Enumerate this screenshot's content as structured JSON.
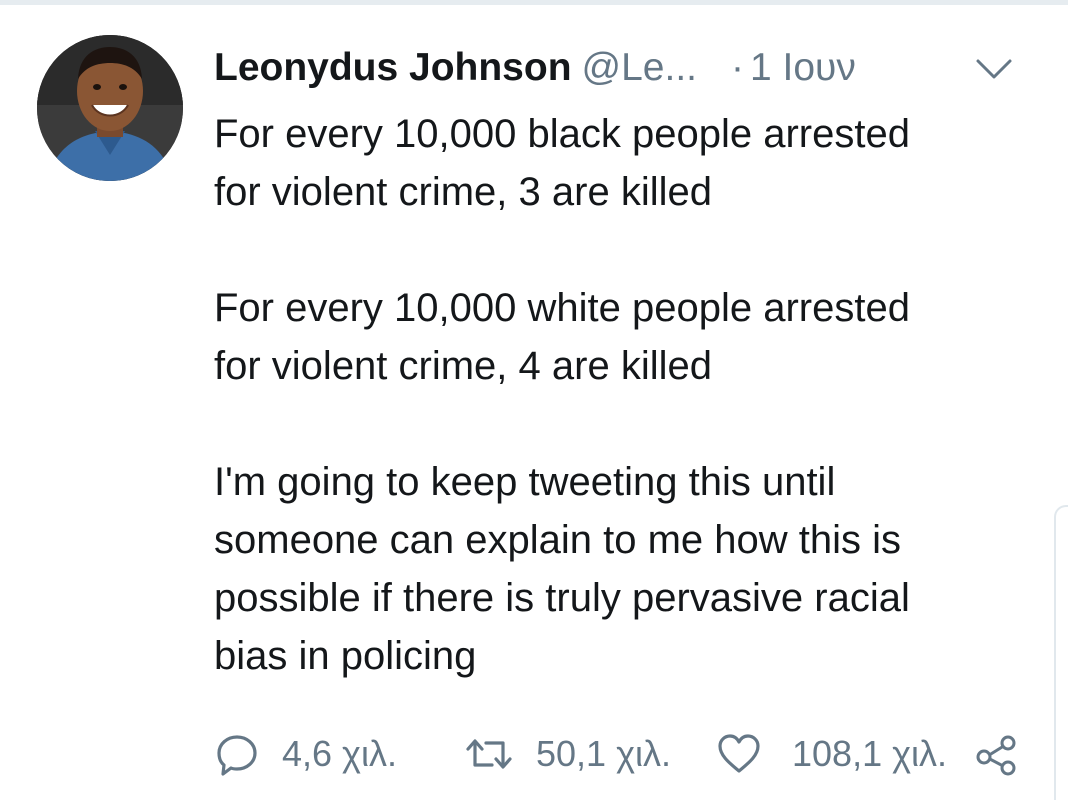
{
  "tweet": {
    "author": {
      "display_name": "Leonydus Johnson",
      "handle": "@Le...",
      "avatar": "profile-photo"
    },
    "separator": "·",
    "timestamp": "1 Ιουν",
    "menu_icon": "chevron-down-icon",
    "text_lines": [
      "For every 10,000 black people arrested",
      "for violent crime, 3 are killed",
      "For every 10,000 white people arrested",
      "for violent crime, 4 are killed",
      "I'm going to keep tweeting this until",
      "someone can explain to me how this is",
      "possible if there is truly pervasive racial",
      "bias in policing"
    ],
    "actions": {
      "reply": {
        "icon": "reply-icon",
        "count": "4,6 χιλ."
      },
      "retweet": {
        "icon": "retweet-icon",
        "count": "50,1 χιλ."
      },
      "like": {
        "icon": "heart-icon",
        "count": "108,1 χιλ."
      },
      "share": {
        "icon": "share-icon"
      }
    }
  },
  "colors": {
    "text": "#14171a",
    "secondary": "#657786",
    "divider": "#e6ecf0"
  }
}
